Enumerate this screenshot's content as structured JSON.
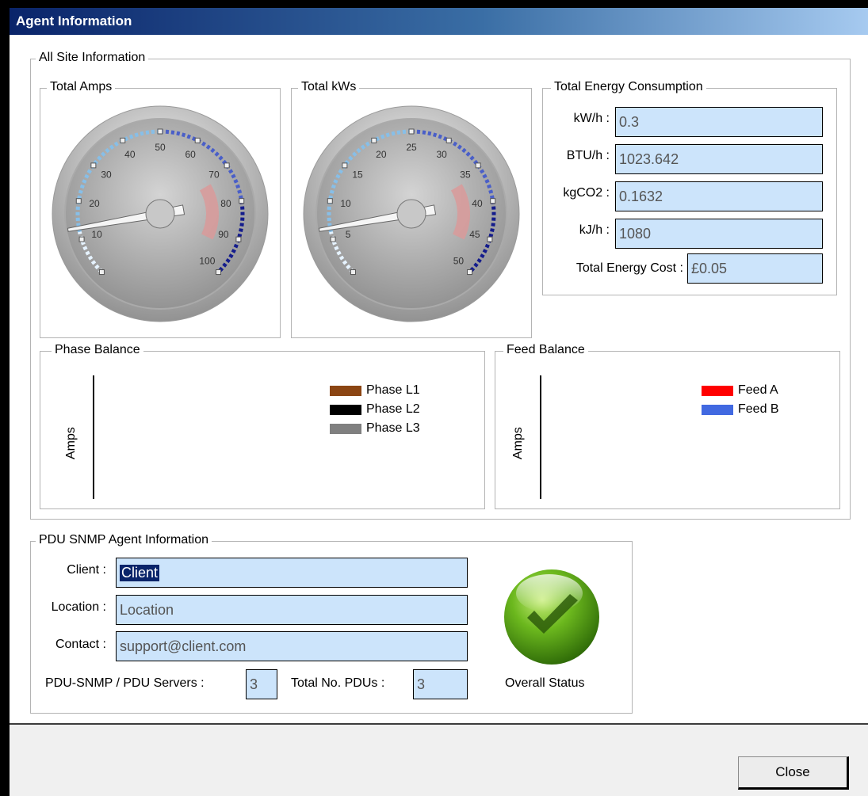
{
  "window": {
    "title": "Agent Information"
  },
  "site": {
    "group_label": "All Site Information",
    "amps": {
      "label": "Total Amps",
      "min": 0,
      "max": 100,
      "value": 13,
      "ticks": [
        "10",
        "20",
        "30",
        "40",
        "50",
        "60",
        "70",
        "80",
        "90",
        "100"
      ]
    },
    "kws": {
      "label": "Total kWs",
      "min": 0,
      "max": 50,
      "value": 6.5,
      "ticks": [
        "5",
        "10",
        "15",
        "20",
        "25",
        "30",
        "35",
        "40",
        "45",
        "50"
      ]
    },
    "energy": {
      "label": "Total Energy Consumption",
      "kwh_label": "kW/h :",
      "kwh_value": "0.3",
      "btu_label": "BTU/h :",
      "btu_value": "1023.642",
      "co2_label": "kgCO2 :",
      "co2_value": "0.1632",
      "kj_label": "kJ/h :",
      "kj_value": "1080",
      "cost_label": "Total Energy Cost :",
      "cost_value": "£0.05"
    },
    "phase": {
      "label": "Phase Balance",
      "axis": "Amps",
      "legend": [
        {
          "name": "Phase L1",
          "color": "#8b4513"
        },
        {
          "name": "Phase L2",
          "color": "#000000"
        },
        {
          "name": "Phase L3",
          "color": "#808080"
        }
      ]
    },
    "feed": {
      "label": "Feed Balance",
      "axis": "Amps",
      "legend": [
        {
          "name": "Feed A",
          "color": "#ff0000"
        },
        {
          "name": "Feed B",
          "color": "#4169e1"
        }
      ]
    }
  },
  "pdu": {
    "group_label": "PDU SNMP Agent Information",
    "client_label": "Client :",
    "client_value": "Client",
    "location_label": "Location :",
    "location_value": "Location",
    "contact_label": "Contact :",
    "contact_value": "support@client.com",
    "servers_label": "PDU-SNMP / PDU Servers :",
    "servers_value": "3",
    "pdus_label": "Total No. PDUs :",
    "pdus_value": "3",
    "status_label": "Overall Status",
    "status_icon": "check-icon"
  },
  "footer": {
    "close_label": "Close"
  }
}
